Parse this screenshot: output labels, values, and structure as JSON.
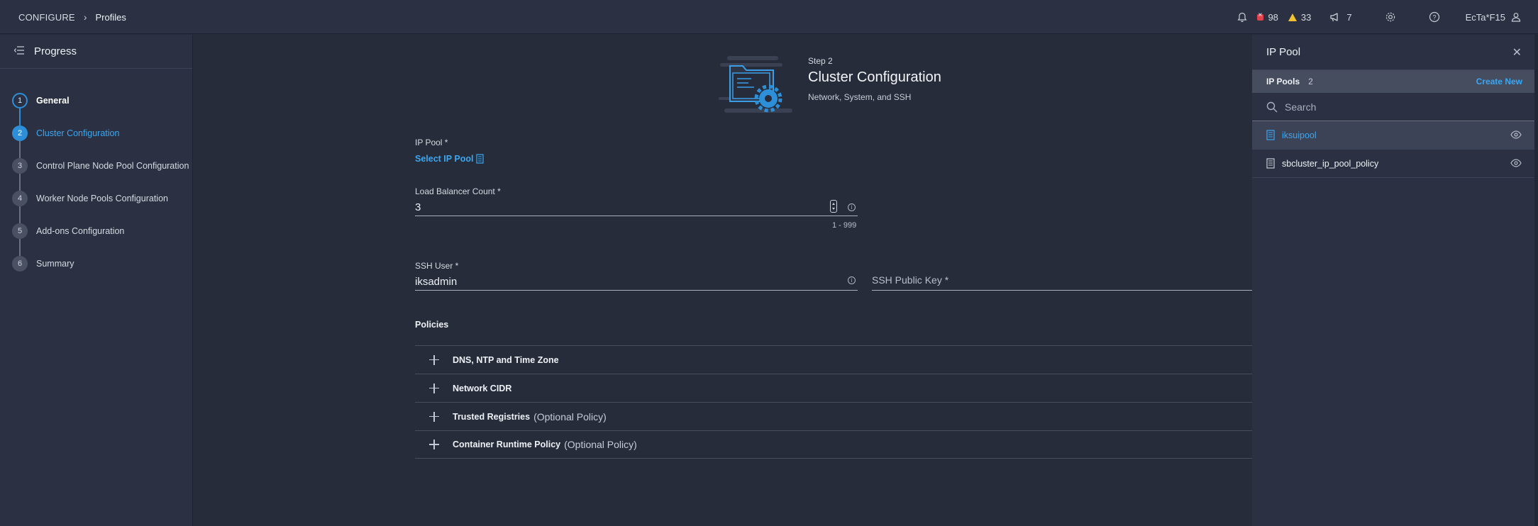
{
  "topbar": {
    "breadcrumb_root": "CONFIGURE",
    "breadcrumb_sep": "›",
    "breadcrumb_current": "Profiles",
    "critical_count": "98",
    "warning_count": "33",
    "announcement_count": "7",
    "user": "EcTa*F15"
  },
  "progress": {
    "title": "Progress",
    "steps": [
      {
        "num": "1",
        "label": "General"
      },
      {
        "num": "2",
        "label": "Cluster Configuration"
      },
      {
        "num": "3",
        "label": "Control Plane Node Pool Configuration"
      },
      {
        "num": "4",
        "label": "Worker Node Pools Configuration"
      },
      {
        "num": "5",
        "label": "Add-ons Configuration"
      },
      {
        "num": "6",
        "label": "Summary"
      }
    ]
  },
  "header": {
    "step": "Step 2",
    "title": "Cluster Configuration",
    "subtitle": "Network, System, and SSH"
  },
  "form": {
    "ip_pool_label": "IP Pool *",
    "ip_pool_link": "Select IP Pool",
    "lb_label": "Load Balancer Count *",
    "lb_value": "3",
    "lb_hint": "1 - 999",
    "ssh_user_label": "SSH User *",
    "ssh_user_value": "iksadmin",
    "ssh_key_placeholder": "SSH Public Key *"
  },
  "policies": {
    "title": "Policies",
    "items": [
      {
        "name": "DNS, NTP and Time Zone",
        "optional": ""
      },
      {
        "name": "Network CIDR",
        "optional": ""
      },
      {
        "name": "Trusted Registries",
        "optional": "(Optional Policy)"
      },
      {
        "name": "Container Runtime Policy",
        "optional": "(Optional Policy)"
      }
    ]
  },
  "drawer": {
    "title": "IP Pool",
    "list_title": "IP Pools",
    "list_count": "2",
    "create_label": "Create New",
    "search_placeholder": "Search",
    "items": [
      "iksuipool",
      "sbcluster_ip_pool_policy"
    ]
  },
  "colors": {
    "accent": "#2d8fd8",
    "link": "#3ba7f2",
    "critical": "#e0434b",
    "warning": "#f2c230"
  }
}
